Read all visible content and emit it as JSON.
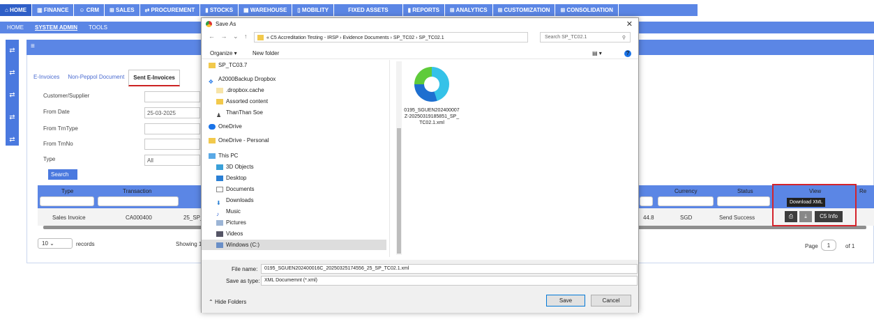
{
  "topnav": {
    "tabs": [
      "⌂ HOME",
      "▥ FINANCE",
      "☺ CRM",
      "⊞ SALES",
      "⇄ PROCUREMENT",
      "▮ STOCKS",
      "▦ WAREHOUSE",
      "▯ MOBILITY",
      "FIXED ASSETS",
      "▮ REPORTS",
      "⊞ ANALYTICS",
      "⊞ CUSTOMIZATION",
      "⊞ CONSOLIDATION"
    ]
  },
  "subnav": {
    "home": "HOME",
    "system_admin": "SYSTEM ADMIN",
    "tools": "TOOLS"
  },
  "tabs": {
    "einvoices": "E-Invoices",
    "nonpeppol": "Non-Peppol Document",
    "sent": "Sent E-Invoices"
  },
  "form": {
    "customer_label": "Customer/Supplier",
    "from_date_label": "From Date",
    "from_date_value": "25-03-2025",
    "from_trntype_label": "From TrnType",
    "from_trnno_label": "From TrnNo",
    "type_label": "Type",
    "type_value": "All",
    "search_label": "Search"
  },
  "grid": {
    "headers": {
      "type": "Type",
      "transaction": "Transaction",
      "currency": "Currency",
      "status": "Status",
      "view": "View",
      "re": "Re"
    },
    "row": {
      "type": "Sales Invoice",
      "transaction": "CA000400",
      "num": "25_SP_T",
      "amount": "44.8",
      "currency": "SGD",
      "status": "Send Success"
    },
    "records_value": "10",
    "records_label": "records",
    "showing": "Showing 1",
    "tooltip": "Download XML",
    "c5info": "C5 Info",
    "page_label": "Page",
    "page_value": "1",
    "of_label": "of 1"
  },
  "dialog": {
    "title": "Save As",
    "address": "« C5 Accreditation Testing - IRSP  ›  Evidence Documents  ›  SP_TC02  ›  SP_TC02.1",
    "search_placeholder": "Search SP_TC02.1",
    "organize": "Organize ▾",
    "new_folder": "New folder",
    "tree": [
      "SP_TC03.7",
      "A2000Backup Dropbox",
      ".dropbox.cache",
      "Assorted content",
      "ThanThan Soe",
      "OneDrive",
      "OneDrive - Personal",
      "This PC",
      "3D Objects",
      "Desktop",
      "Documents",
      "Downloads",
      "Music",
      "Pictures",
      "Videos",
      "Windows (C:)"
    ],
    "file_name": "0195_SGUEN202400007Z-20250319185851_SP_TC02.1.xml",
    "file_name_label": "File name:",
    "file_name_value": "0195_SGUEN202400016C_20250325174556_25_SP_TC02.1.xml",
    "save_type_label": "Save as type:",
    "save_type_value": "XML Documemnt (*.xml)",
    "hide_folders": "Hide Folders",
    "save": "Save",
    "cancel": "Cancel"
  }
}
